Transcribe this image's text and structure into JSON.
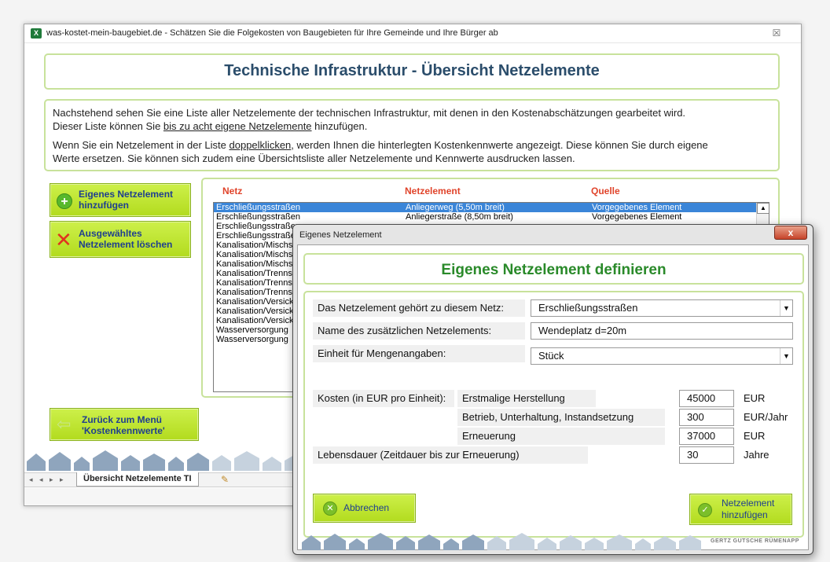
{
  "main_window": {
    "app_icon": "excel-icon",
    "title": "was-kostet-mein-baugebiet.de - Schätzen Sie die Folgekosten von Baugebieten für Ihre Gemeinde und Ihre Bürger ab",
    "close_glyph": "☒",
    "header_title": "Technische Infrastruktur - Übersicht Netzelemente",
    "info": {
      "line1": "Nachstehend sehen Sie eine Liste aller Netzelemente der technischen Infrastruktur, mit denen in den Kostenabschätzungen gearbeitet wird.",
      "line2_pre": "Dieser Liste können Sie ",
      "line2_link": "bis zu acht eigene Netzelemente",
      "line2_post": " hinzufügen.",
      "line3_pre": "Wenn Sie ein Netzelement in der Liste ",
      "line3_link": "doppelklicken",
      "line3_post": ", werden Ihnen die hinterlegten Kostenkennwerte angezeigt. Diese können Sie durch eigene",
      "line4": "Werte ersetzen. Sie können sich zudem eine Übersichtsliste aller Netzelemente und Kennwerte ausdrucken lassen."
    },
    "buttons": {
      "add_line1": "Eigenes Netzelement",
      "add_line2": "hinzufügen",
      "delete_line1": "Ausgewähltes",
      "delete_line2": "Netzelement löschen",
      "back_line1": "Zurück zum Menü",
      "back_line2": "'Kostenkennwerte'"
    },
    "list": {
      "columns": [
        "Netz",
        "Netzelement",
        "Quelle"
      ],
      "rows": [
        {
          "netz": "Erschließungsstraßen",
          "element": "Anliegerweg (5,50m breit)",
          "quelle": "Vorgegebenes Element",
          "selected": true
        },
        {
          "netz": "Erschließungsstraßen",
          "element": "Anliegerstraße (8,50m breit)",
          "quelle": "Vorgegebenes Element"
        },
        {
          "netz": "Erschließungsstraßen",
          "element": "",
          "quelle": ""
        },
        {
          "netz": "Erschließungsstraßen",
          "element": "",
          "quelle": ""
        },
        {
          "netz": "Kanalisation/Mischsystem",
          "element": "",
          "quelle": ""
        },
        {
          "netz": "Kanalisation/Mischsystem",
          "element": "",
          "quelle": ""
        },
        {
          "netz": "Kanalisation/Mischsystem",
          "element": "",
          "quelle": ""
        },
        {
          "netz": "Kanalisation/Trennsystem",
          "element": "",
          "quelle": ""
        },
        {
          "netz": "Kanalisation/Trennsystem",
          "element": "",
          "quelle": ""
        },
        {
          "netz": "Kanalisation/Trennsystem",
          "element": "",
          "quelle": ""
        },
        {
          "netz": "Kanalisation/Versickerung",
          "element": "",
          "quelle": ""
        },
        {
          "netz": "Kanalisation/Versickerung",
          "element": "",
          "quelle": ""
        },
        {
          "netz": "Kanalisation/Versickerung",
          "element": "",
          "quelle": ""
        },
        {
          "netz": "Wasserversorgung",
          "element": "",
          "quelle": ""
        },
        {
          "netz": "Wasserversorgung",
          "element": "",
          "quelle": ""
        }
      ]
    },
    "sheet_tab": "Übersicht Netzelemente TI",
    "sheet_nav": "◂ ◂ ▸ ▸"
  },
  "dialog": {
    "title": "Eigenes Netzelement",
    "close_glyph": "x",
    "header_title": "Eigenes Netzelement definieren",
    "fields": {
      "netz_label": "Das Netzelement gehört zu diesem Netz:",
      "netz_value": "Erschließungsstraßen",
      "name_label": "Name des zusätzlichen Netzelements:",
      "name_value": "Wendeplatz d=20m",
      "einheit_label": "Einheit für Mengenangaben:",
      "einheit_value": "Stück"
    },
    "costs": {
      "label": "Kosten (in EUR pro Einheit):",
      "herstellung_label": "Erstmalige Herstellung",
      "herstellung_value": "45000",
      "herstellung_unit": "EUR",
      "betrieb_label": "Betrieb, Unterhaltung, Instandsetzung",
      "betrieb_value": "300",
      "betrieb_unit": "EUR/Jahr",
      "erneuerung_label": "Erneuerung",
      "erneuerung_value": "37000",
      "erneuerung_unit": "EUR",
      "lebensdauer_label": "Lebensdauer (Zeitdauer bis zur Erneuerung)",
      "lebensdauer_value": "30",
      "lebensdauer_unit": "Jahre"
    },
    "buttons": {
      "cancel": "Abbrechen",
      "submit_line1": "Netzelement",
      "submit_line2": "hinzufügen"
    },
    "brand": "GERTZ GUTSCHE RÜMENAPP"
  },
  "colors": {
    "accent_green": "#b8de2a",
    "panel_border": "#c8e29b",
    "header_blue": "#2b4d6b",
    "dialog_header_green": "#2a8a2a",
    "column_red": "#e0442b",
    "selection_blue": "#3a85d8"
  }
}
